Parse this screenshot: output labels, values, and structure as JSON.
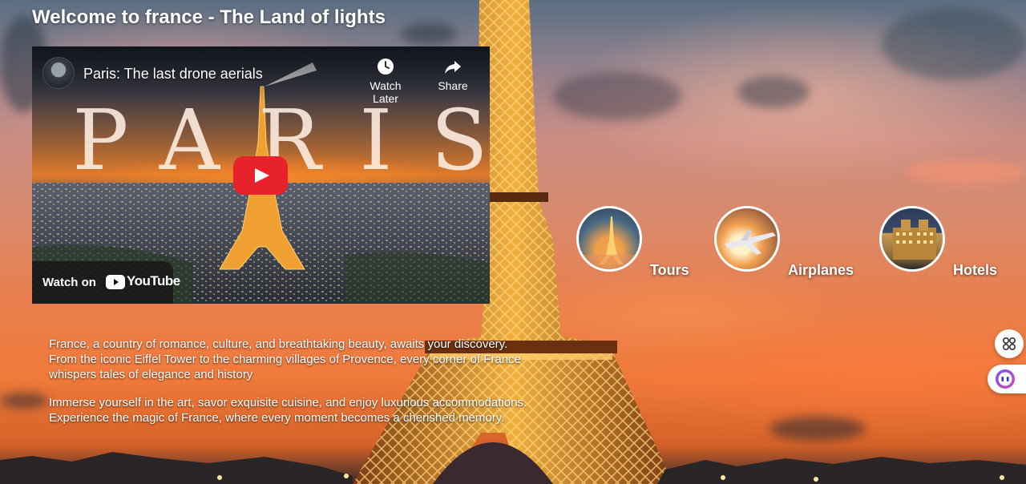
{
  "page": {
    "title": "Welcome to france - The Land of lights"
  },
  "video": {
    "title": "Paris: The last drone aerials",
    "overlay_word": "PARIS",
    "watch_later_label": "Watch Later",
    "share_label": "Share",
    "watch_on_label": "Watch on",
    "youtube_label": "YouTube",
    "icons": {
      "watch_later": "clock-icon",
      "share": "share-arrow-icon",
      "play": "play-icon"
    }
  },
  "description": {
    "paragraph_1": "France, a country of romance, culture, and breathtaking beauty, awaits your discovery. From the iconic Eiffel Tower to the charming villages of Provence, every corner of France whispers tales of elegance and history",
    "paragraph_2": "Immerse yourself in the art, savor exquisite cuisine, and enjoy luxurious accommodations. Experience the magic of France, where every moment becomes a cherished memory."
  },
  "categories": [
    {
      "label": "Tours"
    },
    {
      "label": "Airplanes"
    },
    {
      "label": "Hotels"
    }
  ],
  "widgets": {
    "apps_icon": "grid-icon",
    "assistant_icon": "assistant-bot-icon"
  },
  "colors": {
    "youtube_red": "#e8222b",
    "text": "#ffffff",
    "assistant_accent": "#4a3fd8"
  }
}
